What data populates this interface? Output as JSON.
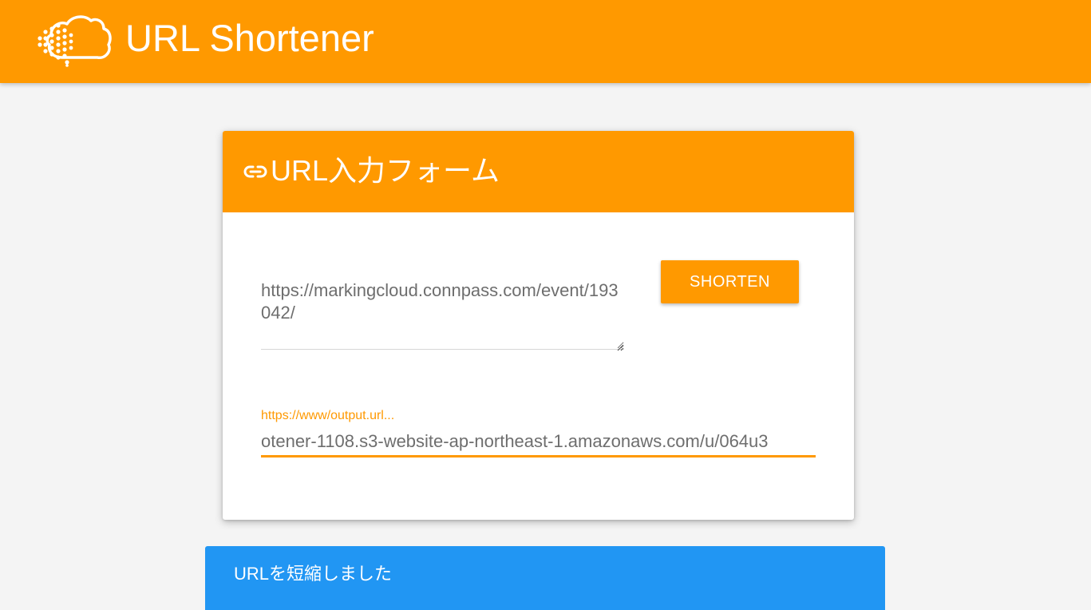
{
  "app_bar": {
    "title": "URL Shortener",
    "logo_icon": "cloud-dots-logo-icon",
    "color": "#ff9900"
  },
  "form_card": {
    "title": "URL入力フォーム",
    "title_icon": "link-icon",
    "url_input_value": "https://markingcloud.connpass.com/event/193042/",
    "shorten_label": "Shorten",
    "output_label": "https://www/output.url...",
    "output_value": "otener-1108.s3-website-ap-northeast-1.amazonaws.com/u/064u3",
    "accent_color": "#ff9900"
  },
  "notification": {
    "message": "URLを短縮しました",
    "color": "#2196f3"
  }
}
